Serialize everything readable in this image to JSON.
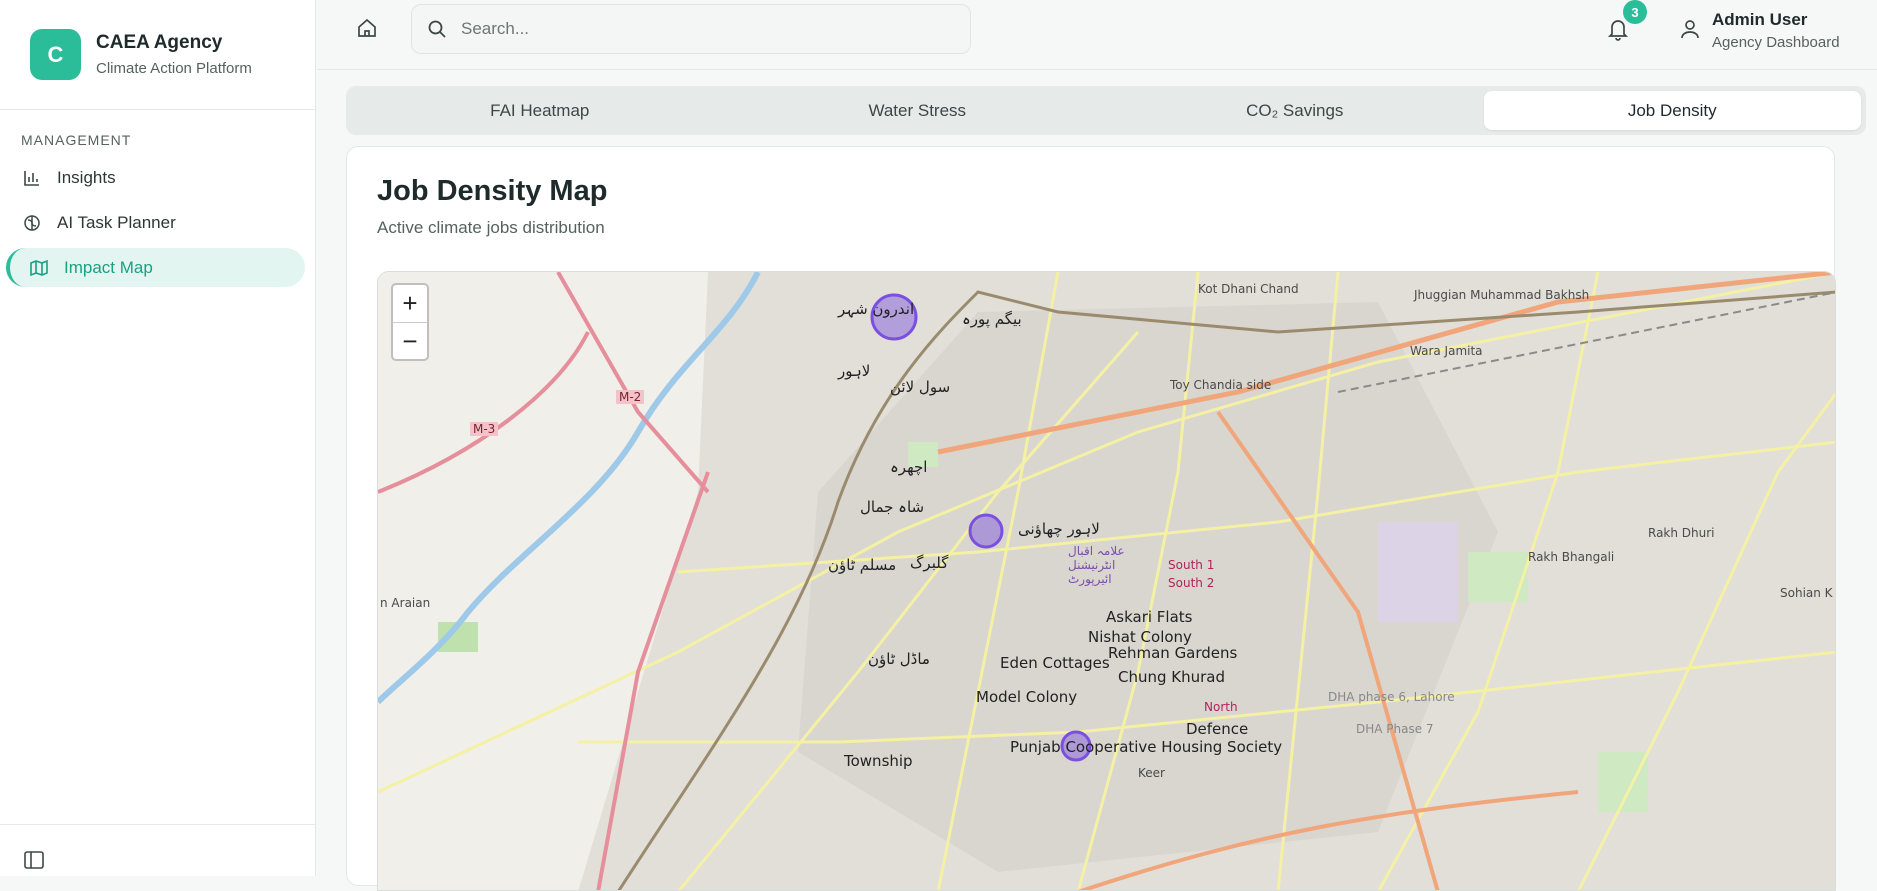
{
  "brand": {
    "logo_letter": "C",
    "name": "CAEA Agency",
    "subtitle": "Climate Action Platform"
  },
  "sidebar": {
    "section_label": "MANAGEMENT",
    "items": [
      {
        "label": "Insights",
        "icon": "bar-chart-icon",
        "active": false
      },
      {
        "label": "AI Task Planner",
        "icon": "brain-icon",
        "active": false
      },
      {
        "label": "Impact Map",
        "icon": "map-icon",
        "active": true
      }
    ]
  },
  "topbar": {
    "search_placeholder": "Search...",
    "notification_count": "3",
    "user_name": "Admin User",
    "user_role": "Agency Dashboard"
  },
  "tabs": [
    {
      "label": "FAI Heatmap",
      "active": false
    },
    {
      "label": "Water Stress",
      "active": false
    },
    {
      "label": "CO₂ Savings",
      "active": false
    },
    {
      "label": "Job Density",
      "active": true
    }
  ],
  "card": {
    "title": "Job Density Map",
    "subtitle": "Active climate jobs distribution"
  },
  "map": {
    "zoom_in": "+",
    "zoom_out": "−",
    "marker_color": "#7b4fe0",
    "labels": [
      "Kot Dhani Chand",
      "Jhuggian Muhammad Bakhsh",
      "Wara Jamita",
      "Toy Chandia side",
      "Rakh Dhuri",
      "Rakh Bhangali",
      "Sohian K",
      "South 1",
      "South 2",
      "Askari Flats",
      "Nishat Colony",
      "Rehman Gardens",
      "Chung Khurad",
      "Eden Cottages",
      "Model Colony",
      "Defence",
      "North",
      "DHA phase 6, Lahore",
      "DHA Phase 7",
      "Punjab Cooperative Housing Society",
      "Township",
      "Keer",
      "n Araian",
      "M-2",
      "M-3",
      "لاہور",
      "سول لائن",
      "اندرون شہر",
      "بیگم پورہ",
      "گلبرگ",
      "ماڈل ٹاؤن",
      "لاہور چھاؤنی",
      "شاہ جمال",
      "اچھرہ",
      "مسلم ٹاؤن",
      "علامہ اقبال انٹرنیشنل ائیرپورٹ"
    ]
  }
}
